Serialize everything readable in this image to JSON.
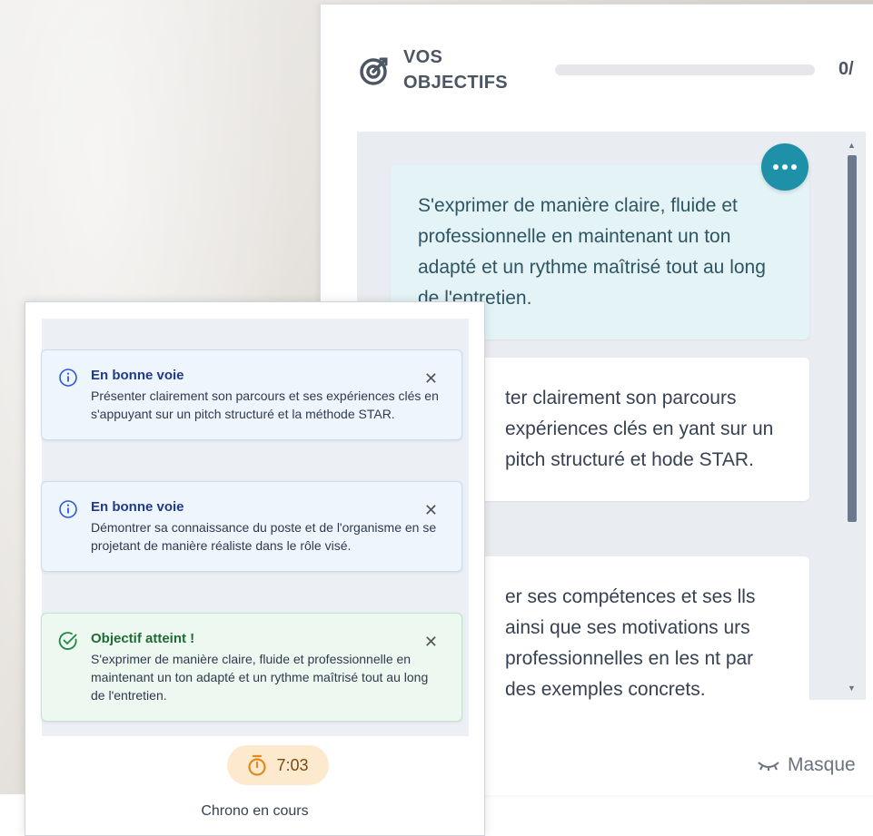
{
  "objectives_panel": {
    "title": "VOS OBJECTIFS",
    "count": "0/",
    "progress_fraction": 0.0,
    "cards": [
      {
        "text": "S'exprimer de manière claire, fluide et professionnelle en maintenant un ton adapté et un rythme maîtrisé tout au long de l'entretien.",
        "state": "done"
      },
      {
        "text": "ter clairement son parcours expériences clés en yant sur un pitch structuré et hode STAR.",
        "state": "pending"
      },
      {
        "text": "er ses compétences et ses lls ainsi que ses motivations urs professionnelles en les nt par des exemples concrets.",
        "state": "pending"
      }
    ],
    "more_button_icon": "ellipsis-icon",
    "hide_link": "Masque",
    "hide_icon": "eye-closed-icon"
  },
  "notifications": [
    {
      "type": "info",
      "title": "En bonne voie",
      "text": "Présenter clairement son parcours et ses expériences clés en s'appuyant sur un pitch structuré et la méthode STAR.",
      "close": "✕"
    },
    {
      "type": "info",
      "title": "En bonne voie",
      "text": "Démontrer sa connaissance du poste et de l'organisme en se projetant de manière réaliste dans le rôle visé.",
      "close": "✕"
    },
    {
      "type": "success",
      "title": "Objectif atteint !",
      "text": "S'exprimer de manière claire, fluide et professionnelle en maintenant un ton adapté et un rythme maîtrisé tout au long de l'entretien.",
      "close": "✕"
    }
  ],
  "timer": {
    "value": "7:03",
    "status": "Chrono en cours",
    "icon": "stopwatch-icon"
  },
  "colors": {
    "accent": "#1e91a8",
    "info_title": "#1f3a8a",
    "success_title": "#1f6b36",
    "timer_bg": "#fde9cd",
    "timer_icon": "#e08a1e"
  }
}
